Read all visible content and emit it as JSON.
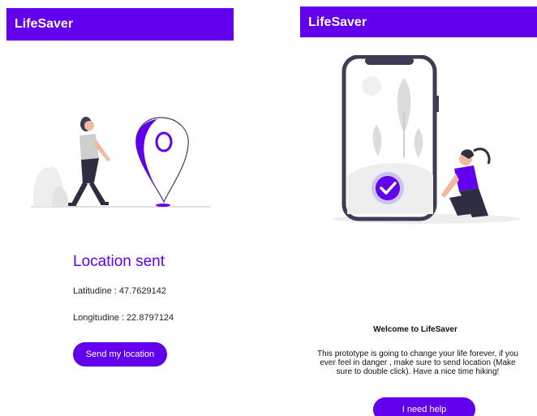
{
  "left_screen": {
    "app_title": "LifeSaver",
    "heading": "Location sent",
    "latitude_text": "Latitudine : 47.7629142",
    "longitude_text": "Longitudine : 22.8797124",
    "button_label": "Send my location"
  },
  "right_screen": {
    "app_title": "LifeSaver",
    "welcome_title": "Welcome to LifeSaver",
    "welcome_body": "This prototype is going to change your life forever, if you ever feel in danger , make sure to send location (Make sure to double click). Have a nice time hiking!",
    "button_label": "I need help"
  },
  "colors": {
    "primary": "#6200EE",
    "illustration_gray": "#CFCFCF",
    "phone_frame": "#3F3D56"
  }
}
